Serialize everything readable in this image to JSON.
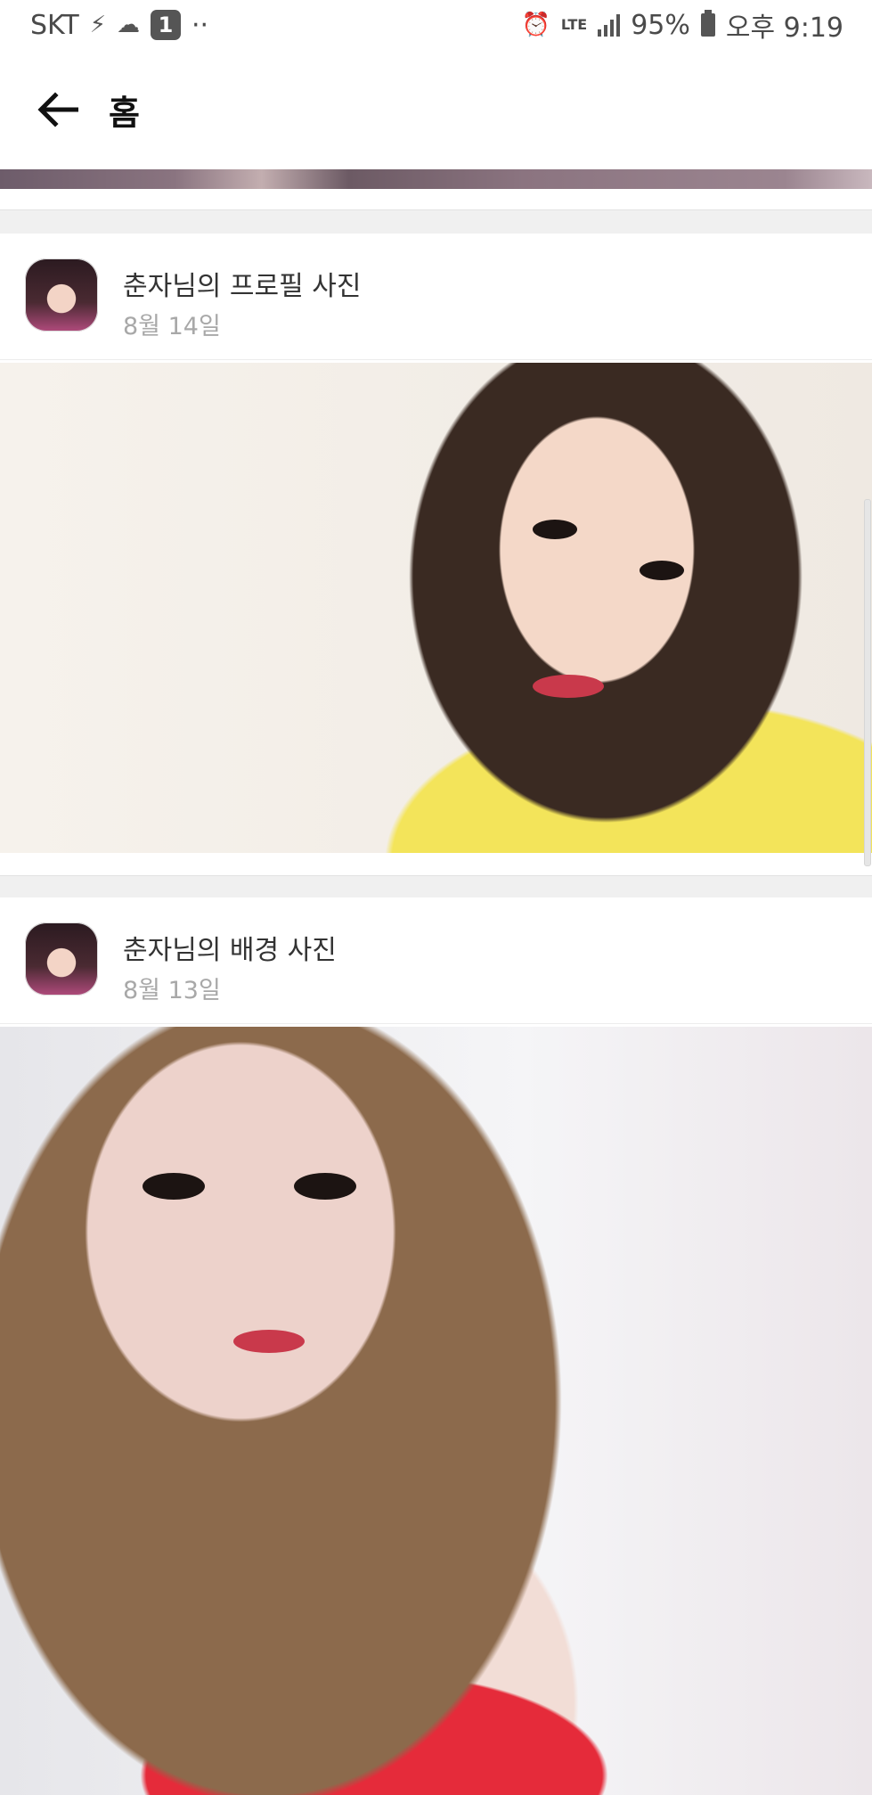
{
  "status_bar": {
    "carrier": "SKT",
    "notification_count": "1",
    "dots": "··",
    "network": "LTE",
    "battery": "95%",
    "time": "오후 9:19"
  },
  "header": {
    "title": "홈"
  },
  "posts": [
    {
      "title": "춘자님의 프로필 사진",
      "date": "8월 14일"
    },
    {
      "title": "춘자님의 배경 사진",
      "date": "8월 13일"
    }
  ],
  "colors": {
    "background": "#ffffff",
    "separator": "#f0f0f0",
    "date_text": "#a8a8a8"
  }
}
